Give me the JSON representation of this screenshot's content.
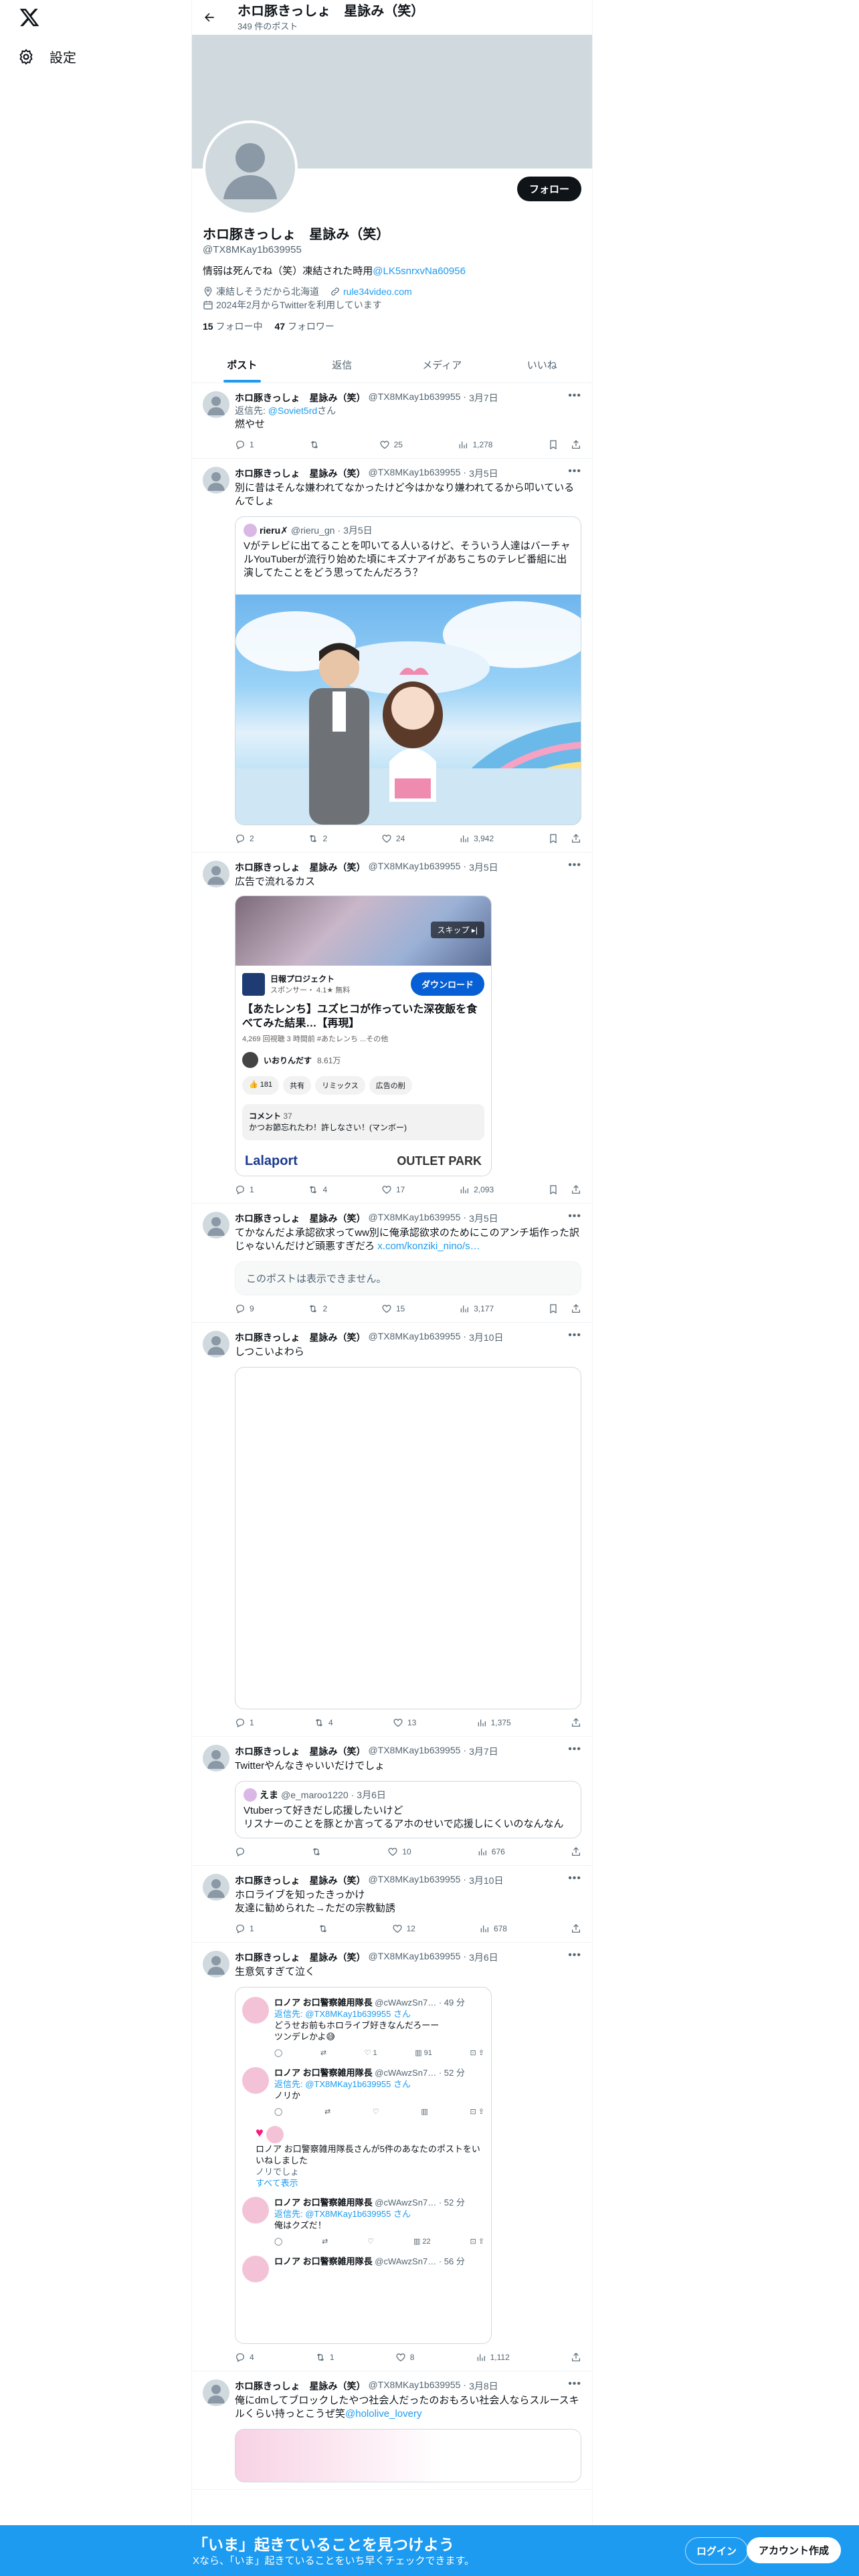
{
  "nav": {
    "settings_label": "設定"
  },
  "header": {
    "title": "ホロ豚きっしょ　星詠み（笑）",
    "post_count": "349 件のポスト"
  },
  "profile": {
    "name": "ホロ豚きっしょ　星詠み（笑）",
    "handle": "@TX8MKay1b639955",
    "bio_text": "情弱は死んでね（笑）凍結された時用",
    "bio_link": "@LK5snrxvNa60956",
    "location": "凍結しそうだから北海道",
    "website": "rule34video.com",
    "joined": "2024年2月からTwitterを利用しています",
    "following_count": "15",
    "following_label": "フォロー中",
    "followers_count": "47",
    "followers_label": "フォロワー",
    "follow_button": "フォロー"
  },
  "tabs": [
    "ポスト",
    "返信",
    "メディア",
    "いいね"
  ],
  "tweets": [
    {
      "name": "ホロ豚きっしょ　星詠み（笑）",
      "handle": "@TX8MKay1b639955",
      "date": "3月7日",
      "reply_prefix": "返信先:",
      "reply_to": "@Soviet5rd",
      "reply_suffix": "さん",
      "text": "燃やせ",
      "replies": "1",
      "retweets": "",
      "likes": "25",
      "views": "1,278"
    },
    {
      "name": "ホロ豚きっしょ　星詠み（笑）",
      "handle": "@TX8MKay1b639955",
      "date": "3月5日",
      "text": "別に昔はそんな嫌われてなかったけど今はかなり嫌われてるから叩いているんでしょ",
      "quote": {
        "name": "rieru✗",
        "handle": "@rieru_gn",
        "date": "3月5日",
        "text": "Vがテレビに出てることを叩いてる人いるけど、そういう人達はバーチャルYouTuberが流行り始めた頃にキズナアイがあちこちのテレビ番組に出演してたことをどう思ってたんだろう？"
      },
      "replies": "2",
      "retweets": "2",
      "likes": "24",
      "views": "3,942"
    },
    {
      "name": "ホロ豚きっしょ　星詠み（笑）",
      "handle": "@TX8MKay1b639955",
      "date": "3月5日",
      "text": "広告で流れるカス",
      "ad": {
        "skip": "スキップ ▸|",
        "advertiser": "日報プロジェクト",
        "sponsor": "スポンサー・ 4.1★ 無料",
        "download": "ダウンロード",
        "title": "【あたレンち】ユズヒコが作っていた深夜飯を食べてみた結果…【再現】",
        "meta": "4,269 回視聴  3 時間前  #あたレンち  ...その他",
        "channel": "いおりんだす",
        "subs": "8.61万",
        "likes": "181",
        "share": "共有",
        "remix": "リミックス",
        "noad": "広告の削",
        "comment_label": "コメント",
        "comment_count": "37",
        "comment_text": "かつお節忘れたわ！許しなさい！(マンボー)",
        "logo1": "Lalaport",
        "logo2": "OUTLET PARK"
      },
      "replies": "1",
      "retweets": "4",
      "likes": "17",
      "views": "2,093"
    },
    {
      "name": "ホロ豚きっしょ　星詠み（笑）",
      "handle": "@TX8MKay1b639955",
      "date": "3月5日",
      "text": "てかなんだよ承認欲求ってww別に俺承認欲求のためにこのアンチ垢作った訳じゃないんだけど頭悪すぎだろ",
      "link": "x.com/konziki_nino/s…",
      "unavailable": "このポストは表示できません。",
      "replies": "9",
      "retweets": "2",
      "likes": "15",
      "views": "3,177"
    },
    {
      "name": "ホロ豚きっしょ　星詠み（笑）",
      "handle": "@TX8MKay1b639955",
      "date": "3月10日",
      "text": "しつこいよわら",
      "replies": "1",
      "retweets": "4",
      "likes": "13",
      "views": "1,375"
    },
    {
      "name": "ホロ豚きっしょ　星詠み（笑）",
      "handle": "@TX8MKay1b639955",
      "date": "3月7日",
      "text": "Twitterやんなきゃいいだけでしょ",
      "quote": {
        "name": "えま",
        "handle": "@e_maroo1220",
        "date": "3月6日",
        "text": "Vtuberって好きだし応援したいけど\nリスナーのことを豚とか言ってるアホのせいで応援しにくいのなんなん"
      },
      "replies": "",
      "retweets": "",
      "likes": "10",
      "views": "676"
    },
    {
      "name": "ホロ豚きっしょ　星詠み（笑）",
      "handle": "@TX8MKay1b639955",
      "date": "3月10日",
      "text": "ホロライブを知ったきっかけ\n友達に勧められた→ただの宗教勧誘",
      "replies": "1",
      "retweets": "",
      "likes": "12",
      "views": "678"
    },
    {
      "name": "ホロ豚きっしょ　星詠み（笑）",
      "handle": "@TX8MKay1b639955",
      "date": "3月6日",
      "text": "生意気すぎて泣く",
      "nested": [
        {
          "name": "ロノア お口警察雑用隊長",
          "handle": "@cWAwzSn7…",
          "time": "49 分",
          "reply": "返信先: @TX8MKay1b639955 さん",
          "text": "どうせお前もホロライブ好きなんだろーー\nツンデレかよ😅",
          "likes": "1",
          "views": "91"
        },
        {
          "name": "ロノア お口警察雑用隊長",
          "handle": "@cWAwzSn7…",
          "time": "52 分",
          "reply": "返信先: @TX8MKay1b639955 さん",
          "text": "ノリか",
          "likes": "",
          "views": ""
        },
        {
          "liked_note": "ロノア お口警察雑用隊長さんが5件のあなたのポストをいいねしました",
          "liked_sub": "ノリでしょ",
          "show_all": "すべて表示"
        },
        {
          "name": "ロノア お口警察雑用隊長",
          "handle": "@cWAwzSn7…",
          "time": "52 分",
          "reply": "返信先: @TX8MKay1b639955 さん",
          "text": "俺はクズだ！",
          "likes": "",
          "views": "22"
        },
        {
          "name": "ロノア お口警察雑用隊長",
          "handle": "@cWAwzSn7…",
          "time": "56 分",
          "reply": "",
          "text": "",
          "likes": "",
          "views": ""
        }
      ],
      "replies": "4",
      "retweets": "1",
      "likes": "8",
      "views": "1,112"
    },
    {
      "name": "ホロ豚きっしょ　星詠み（笑）",
      "handle": "@TX8MKay1b639955",
      "date": "3月8日",
      "text": "俺にdmしてブロックしたやつ社会人だったのおもろい社会人ならスルースキルくらい持っとこうぜ笑",
      "mention": "@hololive_lovery",
      "replies": "",
      "retweets": "",
      "likes": "",
      "views": ""
    }
  ],
  "bottom": {
    "title": "「いま」起きていることを見つけよう",
    "sub": "Xなら、「いま」起きていることをいち早くチェックできます。",
    "login": "ログイン",
    "signup": "アカウント作成"
  }
}
